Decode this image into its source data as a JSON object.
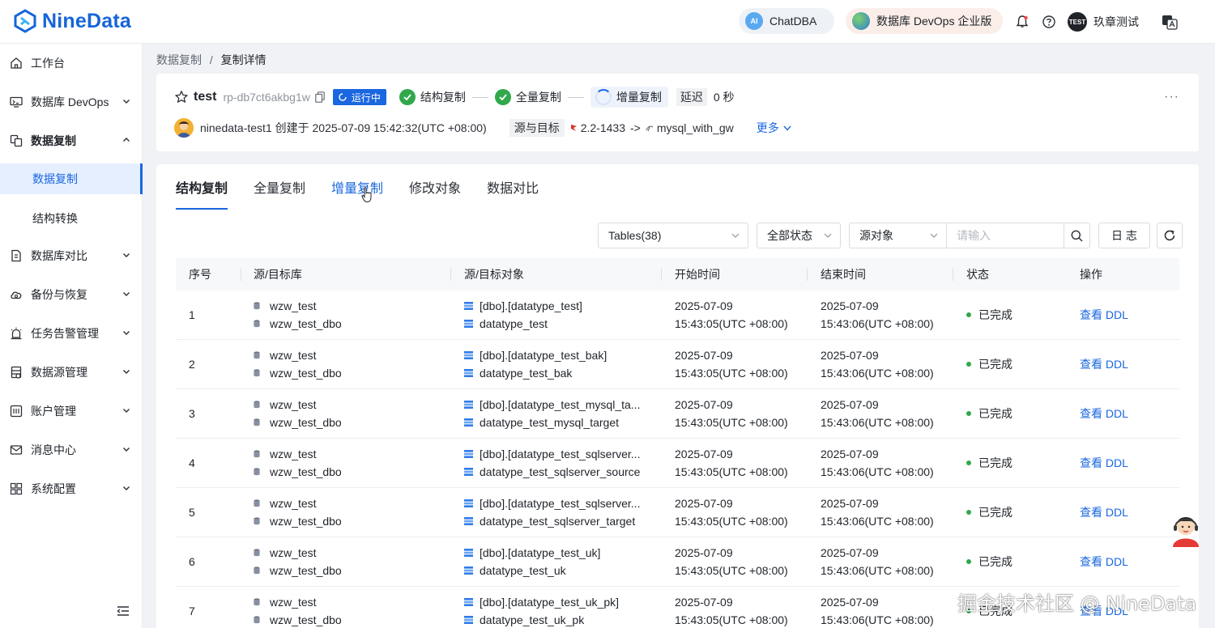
{
  "app": {
    "brand": "NineData"
  },
  "topbar": {
    "chatdba_label": "ChatDBA",
    "chatdba_badge": "AI",
    "devops_label": "数据库 DevOps 企业版",
    "user_badge": "TEST",
    "user_name": "玖章测试"
  },
  "sidebar": {
    "items": [
      {
        "label": "工作台",
        "icon": "home-icon"
      },
      {
        "label": "数据库 DevOps",
        "icon": "monitor-icon"
      },
      {
        "label": "数据复制",
        "icon": "replicate-icon",
        "expanded": true
      },
      {
        "label": "数据库对比",
        "icon": "compare-icon"
      },
      {
        "label": "备份与恢复",
        "icon": "cloud-icon"
      },
      {
        "label": "任务告警管理",
        "icon": "alarm-icon"
      },
      {
        "label": "数据源管理",
        "icon": "datasource-icon"
      },
      {
        "label": "账户管理",
        "icon": "account-icon"
      },
      {
        "label": "消息中心",
        "icon": "mail-icon"
      },
      {
        "label": "系统配置",
        "icon": "grid-icon"
      }
    ],
    "sub_items": [
      "数据复制",
      "结构转换"
    ]
  },
  "breadcrumb": {
    "parent": "数据复制",
    "sep": "/",
    "current": "复制详情"
  },
  "task": {
    "name": "test",
    "id": "rp-db7ct6akbg1w",
    "run_status": "运行中",
    "steps": [
      "结构复制",
      "全量复制",
      "增量复制"
    ],
    "delay_label": "延迟",
    "delay_value": "0 秒",
    "more_dots": "···",
    "creator_line": "ninedata-test1 创建于 2025-07-09 15:42:32(UTC +08:00)",
    "src_tgt_label": "源与目标",
    "source": "2.2-1433",
    "arrow": "->",
    "target": "mysql_with_gw",
    "more_label": "更多"
  },
  "tabs": [
    "结构复制",
    "全量复制",
    "增量复制",
    "修改对象",
    "数据对比"
  ],
  "toolbar": {
    "tables_select": "Tables(38)",
    "status_select": "全部状态",
    "source_select": "源对象",
    "search_placeholder": "请输入",
    "log_button": "日 志"
  },
  "table": {
    "headers": [
      "序号",
      "源/目标库",
      "源/目标对象",
      "开始时间",
      "结束时间",
      "状态",
      "操作"
    ],
    "rows": [
      {
        "idx": "1",
        "src_db": "wzw_test",
        "tgt_db": "wzw_test_dbo",
        "src_obj": "[dbo].[datatype_test]",
        "tgt_obj": "datatype_test",
        "start_date": "2025-07-09",
        "start_time": "15:43:05(UTC +08:00)",
        "end_date": "2025-07-09",
        "end_time": "15:43:06(UTC +08:00)",
        "status": "已完成",
        "action": "查看 DDL"
      },
      {
        "idx": "2",
        "src_db": "wzw_test",
        "tgt_db": "wzw_test_dbo",
        "src_obj": "[dbo].[datatype_test_bak]",
        "tgt_obj": "datatype_test_bak",
        "start_date": "2025-07-09",
        "start_time": "15:43:05(UTC +08:00)",
        "end_date": "2025-07-09",
        "end_time": "15:43:06(UTC +08:00)",
        "status": "已完成",
        "action": "查看 DDL"
      },
      {
        "idx": "3",
        "src_db": "wzw_test",
        "tgt_db": "wzw_test_dbo",
        "src_obj": "[dbo].[datatype_test_mysql_ta...",
        "tgt_obj": "datatype_test_mysql_target",
        "start_date": "2025-07-09",
        "start_time": "15:43:05(UTC +08:00)",
        "end_date": "2025-07-09",
        "end_time": "15:43:06(UTC +08:00)",
        "status": "已完成",
        "action": "查看 DDL"
      },
      {
        "idx": "4",
        "src_db": "wzw_test",
        "tgt_db": "wzw_test_dbo",
        "src_obj": "[dbo].[datatype_test_sqlserver...",
        "tgt_obj": "datatype_test_sqlserver_source",
        "start_date": "2025-07-09",
        "start_time": "15:43:05(UTC +08:00)",
        "end_date": "2025-07-09",
        "end_time": "15:43:06(UTC +08:00)",
        "status": "已完成",
        "action": "查看 DDL"
      },
      {
        "idx": "5",
        "src_db": "wzw_test",
        "tgt_db": "wzw_test_dbo",
        "src_obj": "[dbo].[datatype_test_sqlserver...",
        "tgt_obj": "datatype_test_sqlserver_target",
        "start_date": "2025-07-09",
        "start_time": "15:43:05(UTC +08:00)",
        "end_date": "2025-07-09",
        "end_time": "15:43:06(UTC +08:00)",
        "status": "已完成",
        "action": "查看 DDL"
      },
      {
        "idx": "6",
        "src_db": "wzw_test",
        "tgt_db": "wzw_test_dbo",
        "src_obj": "[dbo].[datatype_test_uk]",
        "tgt_obj": "datatype_test_uk",
        "start_date": "2025-07-09",
        "start_time": "15:43:05(UTC +08:00)",
        "end_date": "2025-07-09",
        "end_time": "15:43:06(UTC +08:00)",
        "status": "已完成",
        "action": "查看 DDL"
      },
      {
        "idx": "7",
        "src_db": "wzw_test",
        "tgt_db": "wzw_test_dbo",
        "src_obj": "[dbo].[datatype_test_uk_pk]",
        "tgt_obj": "datatype_test_uk_pk",
        "start_date": "2025-07-09",
        "start_time": "15:43:05(UTC +08:00)",
        "end_date": "2025-07-09",
        "end_time": "15:43:06(UTC +08:00)",
        "status": "已完成",
        "action": "查看 DDL"
      }
    ]
  },
  "watermark": "掘金技术社区 @ NineData",
  "colors": {
    "primary": "#1a67e0",
    "success": "#30a84b",
    "brand": "#1565d8"
  }
}
